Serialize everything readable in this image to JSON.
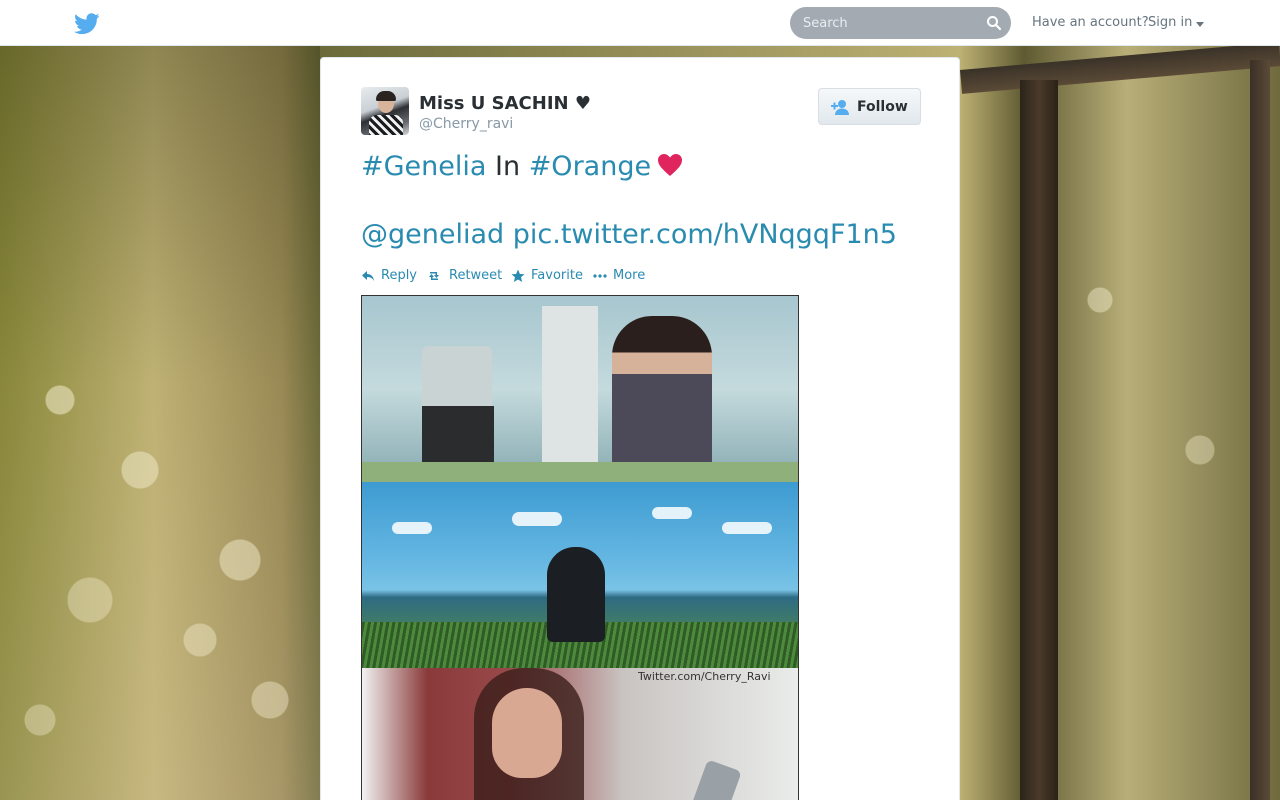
{
  "topbar": {
    "search_placeholder": "Search",
    "have_account": "Have an account?",
    "sign_in": "Sign in"
  },
  "tweet": {
    "fullname": "Miss U SACHIN ♥",
    "username": "@Cherry_ravi",
    "follow_label": "Follow",
    "text": {
      "hashtag1": "#Genelia",
      "word_in": " In ",
      "hashtag2": "#Orange",
      "mention": "@geneliad",
      "pic_link": "pic.twitter.com/hVNqgqF1n5"
    },
    "actions": {
      "reply": "Reply",
      "retweet": "Retweet",
      "favorite": "Favorite",
      "more": "More"
    },
    "media_watermark": "Twitter.com/Cherry_Ravi"
  },
  "colors": {
    "link": "#2a8bb0",
    "heart": "#e0245e",
    "twitter_blue": "#55acee"
  },
  "icons": [
    "twitter-bird-icon",
    "search-icon",
    "caret-down-icon",
    "follow-person-icon",
    "heart-icon",
    "reply-icon",
    "retweet-icon",
    "star-icon",
    "more-dots-icon"
  ]
}
